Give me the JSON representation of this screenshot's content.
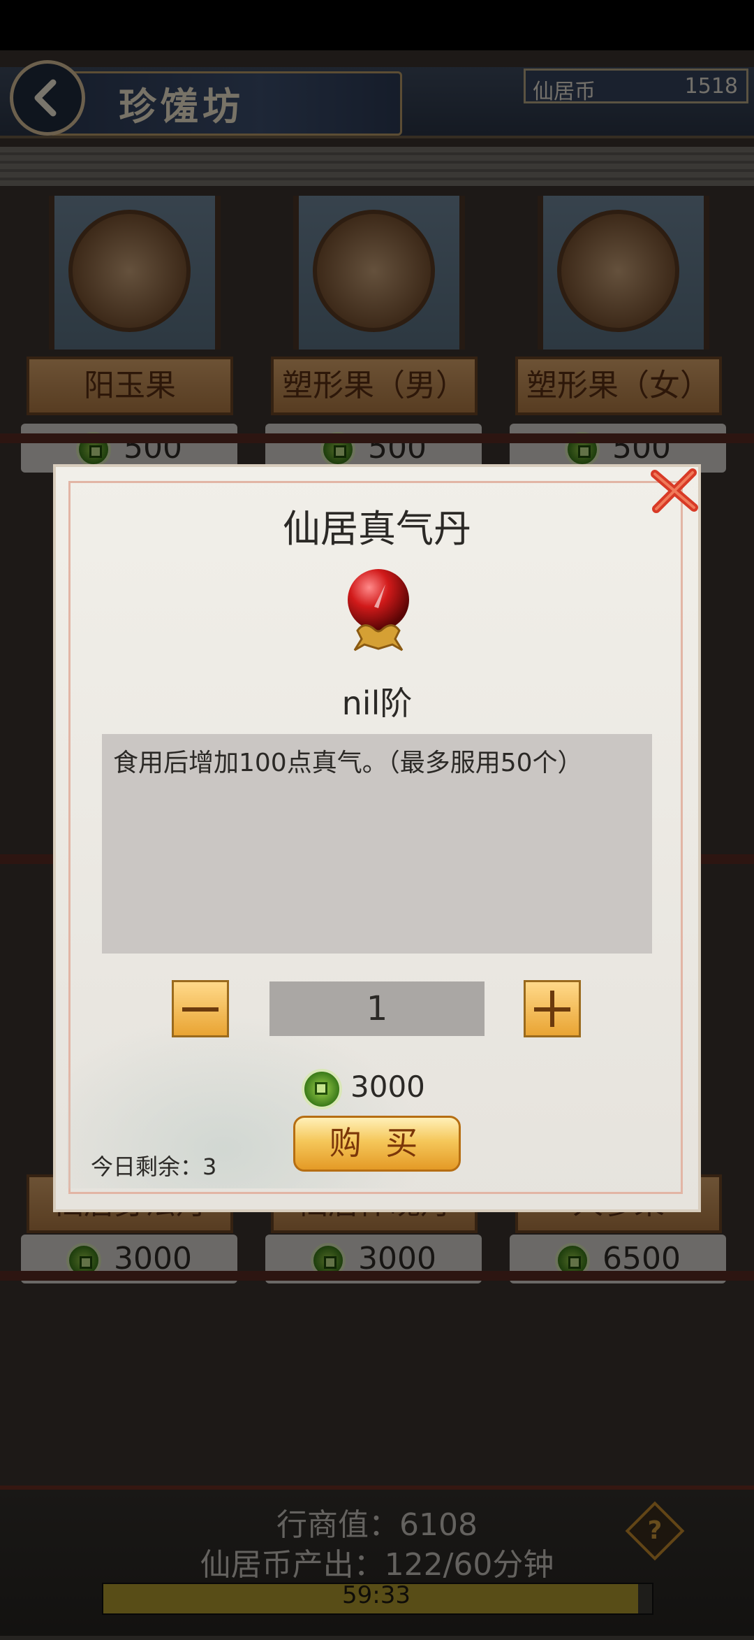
{
  "header": {
    "title": "珍馐坊",
    "currency_label": "仙居币",
    "currency_value": "1518"
  },
  "shop_items": [
    {
      "name": "阳玉果",
      "price": "500"
    },
    {
      "name": "塑形果（男）",
      "price": "500"
    },
    {
      "name": "塑形果（女）",
      "price": "500"
    },
    {
      "name": "仙居身法丹",
      "price": "3000"
    },
    {
      "name": "仙居体魄丹",
      "price": "3000"
    },
    {
      "name": "人参果",
      "price": "6500"
    }
  ],
  "dialog": {
    "title": "仙居真气丹",
    "tier": "nil阶",
    "description": "食用后增加100点真气。（最多服用50个）",
    "quantity": "1",
    "cost": "3000",
    "buy_label": "购 买",
    "remaining": "今日剩余：3"
  },
  "footer": {
    "merchant_value": "行商值：6108",
    "output": "仙居币产出：122/60分钟",
    "timer": "59:33",
    "timer_progress": 0.98
  },
  "colors": {
    "accent_gold": "#e9a433",
    "coin_green": "#3a7a19",
    "dialog_bg": "#f1efe9"
  }
}
